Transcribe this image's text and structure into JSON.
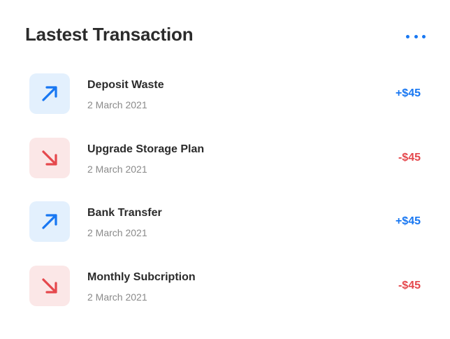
{
  "header": {
    "title": "Lastest Transaction",
    "more_icon": "more-horizontal-icon"
  },
  "colors": {
    "accent_blue": "#1877f2",
    "accent_red": "#e5484d",
    "incoming_bg": "#e3f0fd",
    "outgoing_bg": "#fbe7e7"
  },
  "transactions": [
    {
      "name": "Deposit Waste",
      "date": "2 March 2021",
      "amount": "+$45",
      "direction": "in",
      "icon": "arrow-up-right-icon"
    },
    {
      "name": "Upgrade Storage Plan",
      "date": "2 March 2021",
      "amount": "-$45",
      "direction": "out",
      "icon": "arrow-down-right-icon"
    },
    {
      "name": "Bank Transfer",
      "date": "2 March 2021",
      "amount": "+$45",
      "direction": "in",
      "icon": "arrow-up-right-icon"
    },
    {
      "name": "Monthly Subcription",
      "date": "2 March 2021",
      "amount": "-$45",
      "direction": "out",
      "icon": "arrow-down-right-icon"
    }
  ]
}
